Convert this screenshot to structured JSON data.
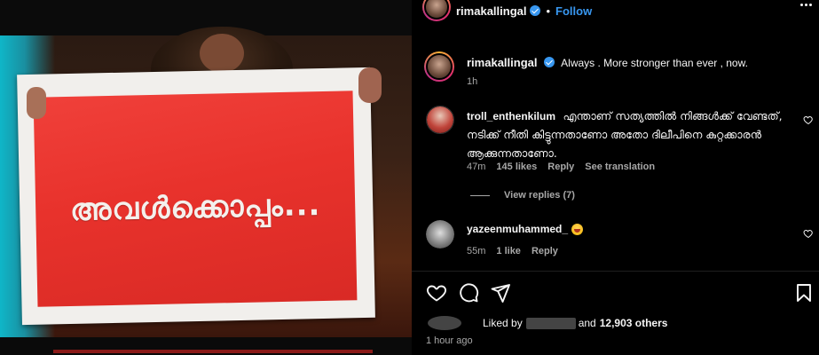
{
  "post_image": {
    "sign_text": "അവൾക്കൊപ്പം..."
  },
  "header": {
    "username": "rimakallingal",
    "separator": "•",
    "follow_label": "Follow"
  },
  "caption": {
    "username": "rimakallingal",
    "text": "Always . More stronger than ever , now.",
    "time": "1h"
  },
  "comments": [
    {
      "username": "troll_enthenkilum",
      "text": "എന്താണ് സത്യത്തിൽ നിങ്ങൾക്ക് വേണ്ടത്, നടിക്ക് നീതി കിട്ടുന്നതാണോ അതോ ദിലീപിനെ കുറ്റക്കാരൻ ആക്കുന്നതാണോ.",
      "time": "47m",
      "likes": "145 likes",
      "reply_label": "Reply",
      "translate_label": "See translation",
      "view_replies_label": "View replies (7)"
    },
    {
      "username": "yazeenmuhammed_",
      "emoji": "laughing-emoji",
      "time": "55m",
      "likes": "1 like",
      "reply_label": "Reply"
    }
  ],
  "footer": {
    "liked_by_prefix": "Liked by",
    "liked_by_suffix_and": "and",
    "others_count": "12,903 others",
    "time_ago": "1 hour ago"
  },
  "colors": {
    "accent_blue": "#3897f0",
    "sign_red": "#e8322c",
    "background": "#000000"
  }
}
